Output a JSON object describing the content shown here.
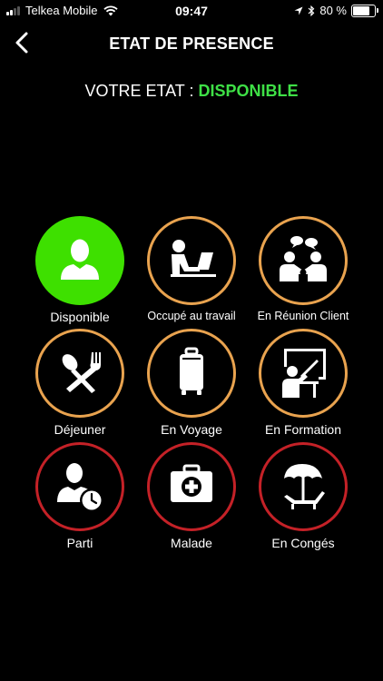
{
  "status_bar": {
    "carrier": "Telkea Mobile",
    "time": "09:47",
    "battery": "80 %",
    "battery_level": 0.8
  },
  "header": {
    "title": "ETAT DE PRESENCE"
  },
  "current_state": {
    "label": "VOTRE ETAT :",
    "value": "DISPONIBLE",
    "value_color": "#3ee046"
  },
  "colors": {
    "available": "#3ee000",
    "busy": "#e9a34f",
    "absent": "#c42127"
  },
  "statuses": [
    {
      "label": "Disponible",
      "icon": "person-icon",
      "ring": "green"
    },
    {
      "label": "Occupé au travail",
      "icon": "person-laptop-icon",
      "ring": "orange"
    },
    {
      "label": "En Réunion Client",
      "icon": "meeting-icon",
      "ring": "orange"
    },
    {
      "label": "Déjeuner",
      "icon": "cutlery-icon",
      "ring": "orange"
    },
    {
      "label": "En Voyage",
      "icon": "suitcase-icon",
      "ring": "orange"
    },
    {
      "label": "En Formation",
      "icon": "teacher-board-icon",
      "ring": "orange"
    },
    {
      "label": "Parti",
      "icon": "person-clock-icon",
      "ring": "red"
    },
    {
      "label": "Malade",
      "icon": "medical-kit-icon",
      "ring": "red"
    },
    {
      "label": "En Congés",
      "icon": "beach-umbrella-icon",
      "ring": "red"
    }
  ]
}
